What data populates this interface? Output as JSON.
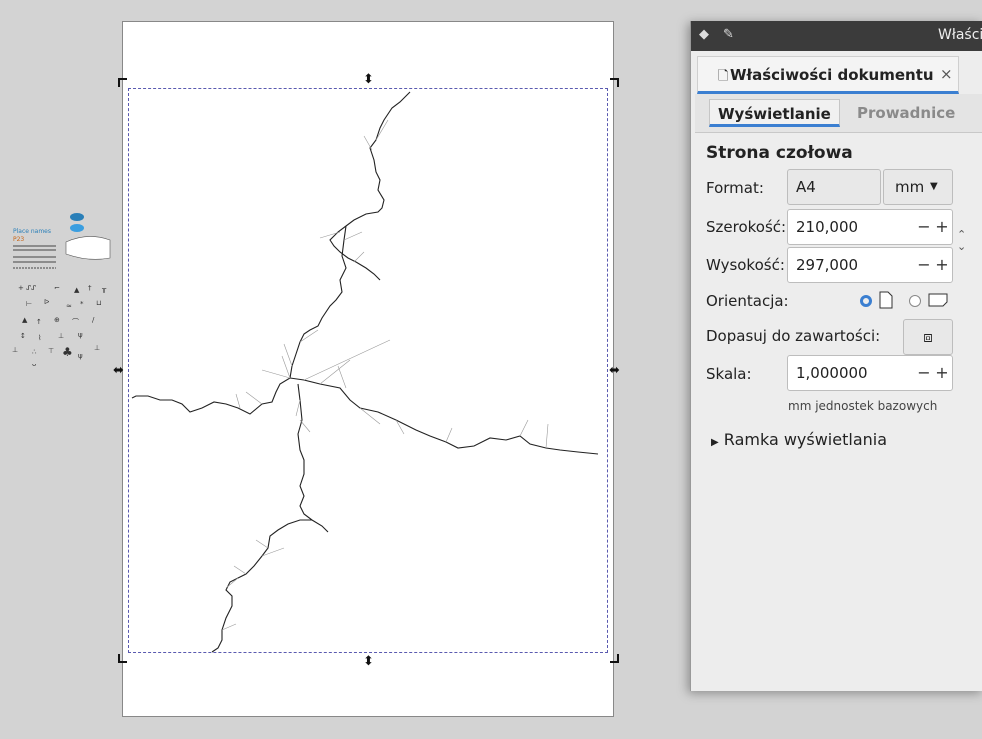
{
  "canvas": {
    "symbols": {
      "place_names": "Place names",
      "code": "P23"
    }
  },
  "panel": {
    "window_title": "Właści",
    "tab_label": "Właściwości dokumentu",
    "tab_close": "×",
    "subtabs": [
      "Wyświetlanie",
      "Prowadnice"
    ],
    "section_title": "Strona czołowa",
    "format": {
      "label": "Format:",
      "value": "A4",
      "unit": "mm"
    },
    "width": {
      "label": "Szerokość:",
      "value": "210,000"
    },
    "height": {
      "label": "Wysokość:",
      "value": "297,000"
    },
    "orientation": {
      "label": "Orientacja:"
    },
    "fit": {
      "label": "Dopasuj do zawartości:"
    },
    "scale": {
      "label": "Skala:",
      "value": "1,000000",
      "note": "mm jednostek bazowych"
    },
    "viewbox_expander": "Ramka wyświetlania",
    "accent_color": "#3b7fd1"
  }
}
